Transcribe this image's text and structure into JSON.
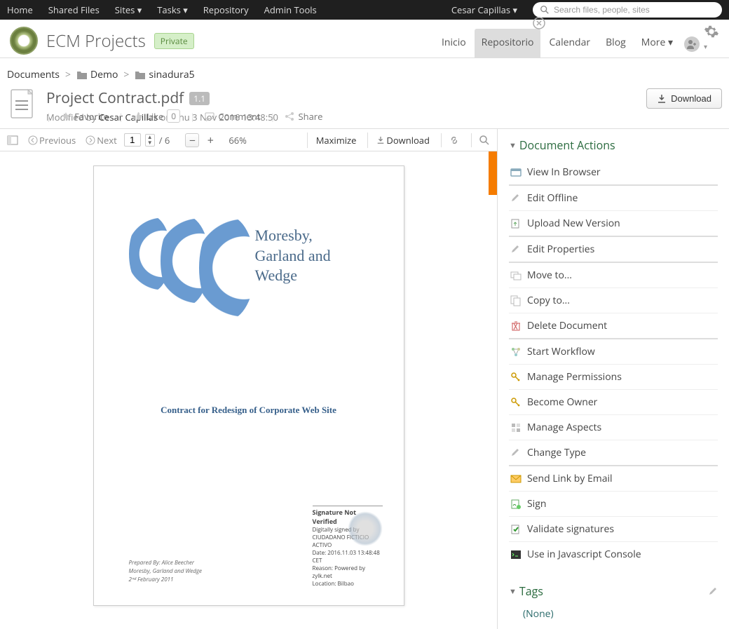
{
  "topbar": {
    "items_left": [
      "Home",
      "Shared Files",
      "Sites ▾",
      "Tasks ▾",
      "Repository",
      "Admin Tools"
    ],
    "user": "Cesar Capillas ▾",
    "search_placeholder": "Search files, people, sites"
  },
  "site": {
    "name": "ECM Projects",
    "privacy": "Private",
    "nav": [
      "Inicio",
      "Repositorio",
      "Calendar",
      "Blog",
      "More ▾"
    ],
    "active_nav": "Repositorio"
  },
  "breadcrumb": [
    "Documents",
    "Demo",
    "sinadura5"
  ],
  "document": {
    "title": "Project Contract.pdf",
    "version": "1.1",
    "modified_prefix": "Modified by ",
    "author": "Cesar Capillas",
    "modified_on": " on Thu 3 Nov 2016 13:48:50",
    "download_label": "Download"
  },
  "social": {
    "favorite": "Favorite",
    "like": "Like",
    "like_count": "0",
    "comment": "Comment",
    "share": "Share"
  },
  "preview_toolbar": {
    "previous": "Previous",
    "next": "Next",
    "page": "1",
    "total_pages": "/ 6",
    "zoom": "66%",
    "maximize": "Maximize",
    "download": "Download"
  },
  "pdf": {
    "brand_l1": "Moresby,",
    "brand_l2": "Garland and",
    "brand_l3": "Wedge",
    "contract_title": "Contract for Redesign of Corporate Web Site",
    "prepared_by": "Prepared By: Alice Beecher",
    "company": "Moresby, Garland and Wedge",
    "date": "2ⁿᵈ February 2011",
    "sig_title": "Signature Not Verified",
    "sig_l1": "Digitally signed by",
    "sig_l2": "CIUDADANO FICTICIO",
    "sig_l3": "ACTIVO",
    "sig_l4": "Date: 2016.11.03 13:48:48",
    "sig_l5": "CET",
    "sig_l6": "Reason: Powered by",
    "sig_l7": "zylk.net",
    "sig_l8": "Location: Bilbao"
  },
  "actions": {
    "panel_title": "Document Actions",
    "items": [
      {
        "label": "View In Browser",
        "icon": "view"
      },
      {
        "label": "Edit Offline",
        "icon": "pencil",
        "sep": true
      },
      {
        "label": "Upload New Version",
        "icon": "upload"
      },
      {
        "label": "Edit Properties",
        "icon": "pencil",
        "sep": true
      },
      {
        "label": "Move to...",
        "icon": "move",
        "sep": true
      },
      {
        "label": "Copy to...",
        "icon": "copy"
      },
      {
        "label": "Delete Document",
        "icon": "delete"
      },
      {
        "label": "Start Workflow",
        "icon": "workflow",
        "sep": true
      },
      {
        "label": "Manage Permissions",
        "icon": "key"
      },
      {
        "label": "Become Owner",
        "icon": "key"
      },
      {
        "label": "Manage Aspects",
        "icon": "aspects"
      },
      {
        "label": "Change Type",
        "icon": "pencil"
      },
      {
        "label": "Send Link by Email",
        "icon": "mail",
        "sep": true
      },
      {
        "label": "Sign",
        "icon": "sign"
      },
      {
        "label": "Validate signatures",
        "icon": "validate"
      },
      {
        "label": "Use in Javascript Console",
        "icon": "console"
      }
    ]
  },
  "tags": {
    "title": "Tags",
    "none": "(None)"
  }
}
